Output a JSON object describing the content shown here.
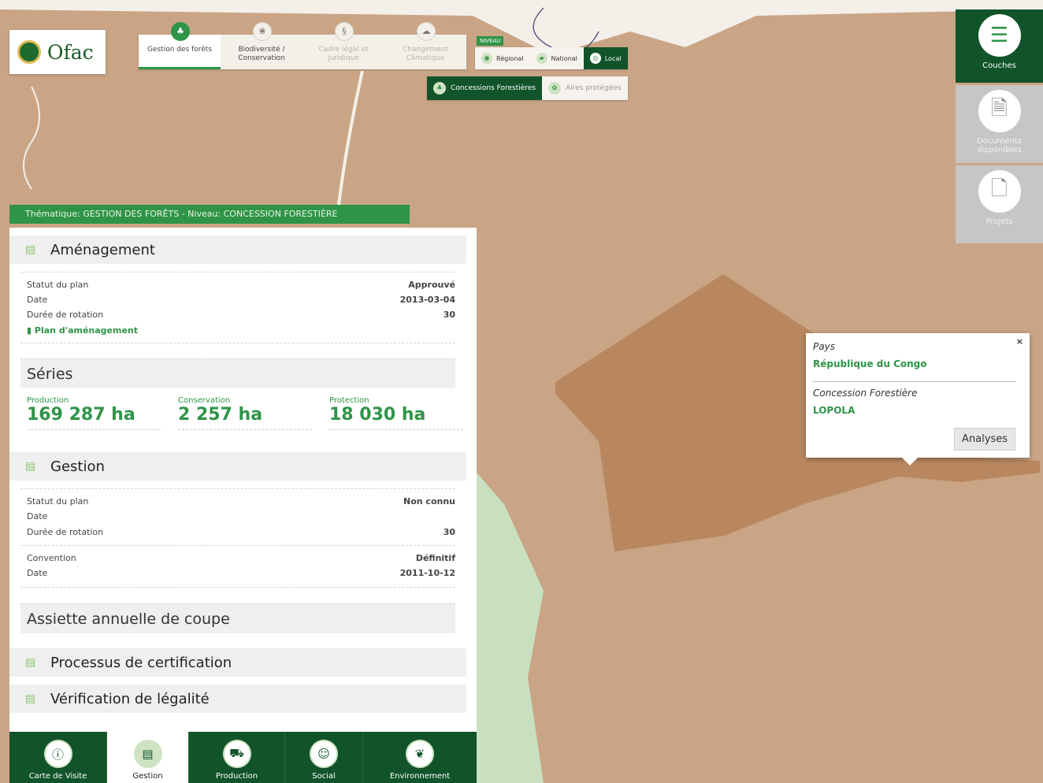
{
  "logo": {
    "text": "Ofac"
  },
  "themes": [
    {
      "label": "Gestion des forêts",
      "icon": "forest-icon",
      "state": "active"
    },
    {
      "label": "Biodiversité / Conservation",
      "icon": "biodiversity-icon",
      "state": "normal"
    },
    {
      "label": "Cadre légal et juridique",
      "icon": "legal-icon",
      "state": "disabled"
    },
    {
      "label": "Changement Climatique",
      "icon": "climate-icon",
      "state": "disabled"
    }
  ],
  "niveau": {
    "label": "NIVEAU",
    "options": [
      {
        "label": "Régional",
        "icon": "regional-icon",
        "active": false
      },
      {
        "label": "National",
        "icon": "national-icon",
        "active": false
      },
      {
        "label": "Local",
        "icon": "local-icon",
        "active": true
      }
    ]
  },
  "sub_filters": [
    {
      "label": "Concessions Forestières",
      "icon": "concession-icon",
      "active": true
    },
    {
      "label": "Aires protégées",
      "icon": "protected-area-icon",
      "active": false
    }
  ],
  "right_panel": [
    {
      "label": "Couches",
      "icon": "layers-icon",
      "active": true
    },
    {
      "label": "Documents disponibles",
      "icon": "documents-icon",
      "active": false
    },
    {
      "label": "Projets",
      "icon": "projects-icon",
      "active": false
    }
  ],
  "breadcrumb": {
    "text": "Thématique: GESTION DES FORÊTS  -  Niveau: CONCESSION FORESTIÈRE"
  },
  "amenagement": {
    "title": "Aménagement",
    "rows": [
      {
        "label": "Statut du plan",
        "value": "Approuvé"
      },
      {
        "label": "Date",
        "value": "2013-03-04"
      },
      {
        "label": "Durée de rotation",
        "value": "30"
      }
    ],
    "link": "Plan d'aménagement"
  },
  "series": {
    "title": "Séries",
    "items": [
      {
        "label": "Production",
        "value": "169 287 ha"
      },
      {
        "label": "Conservation",
        "value": "2 257 ha"
      },
      {
        "label": "Protection",
        "value": "18 030 ha"
      }
    ]
  },
  "gestion": {
    "title": "Gestion",
    "rows": [
      {
        "label": "Statut du plan",
        "value": "Non connu"
      },
      {
        "label": "Date",
        "value": ""
      },
      {
        "label": "Durée de rotation",
        "value": "30"
      }
    ],
    "convention_rows": [
      {
        "label": "Convention",
        "value": "Définitif"
      },
      {
        "label": "Date",
        "value": "2011-10-12"
      }
    ]
  },
  "assiette": {
    "title": "Assiette annuelle de coupe"
  },
  "certification": {
    "title": "Processus de certification"
  },
  "legalite": {
    "title": "Vérification de légalité"
  },
  "bottom_nav": [
    {
      "label": "Carte de Visite",
      "icon": "card-icon",
      "active": false
    },
    {
      "label": "Gestion",
      "icon": "management-icon",
      "active": true
    },
    {
      "label": "Production",
      "icon": "production-icon",
      "active": false
    },
    {
      "label": "Social",
      "icon": "social-icon",
      "active": false
    },
    {
      "label": "Environnement",
      "icon": "environment-icon",
      "active": false
    }
  ],
  "popup": {
    "close": "×",
    "pays_label": "Pays",
    "pays_value": "République du Congo",
    "concession_label": "Concession Forestière",
    "concession_value": "LOPOLA",
    "button": "Analyses"
  },
  "colors": {
    "brand_dark_green": "#11542a",
    "brand_green": "#2f9448",
    "map_bg": "#c9a586",
    "concession_fill": "#b9875f",
    "river_green": "#c8e0c0"
  }
}
